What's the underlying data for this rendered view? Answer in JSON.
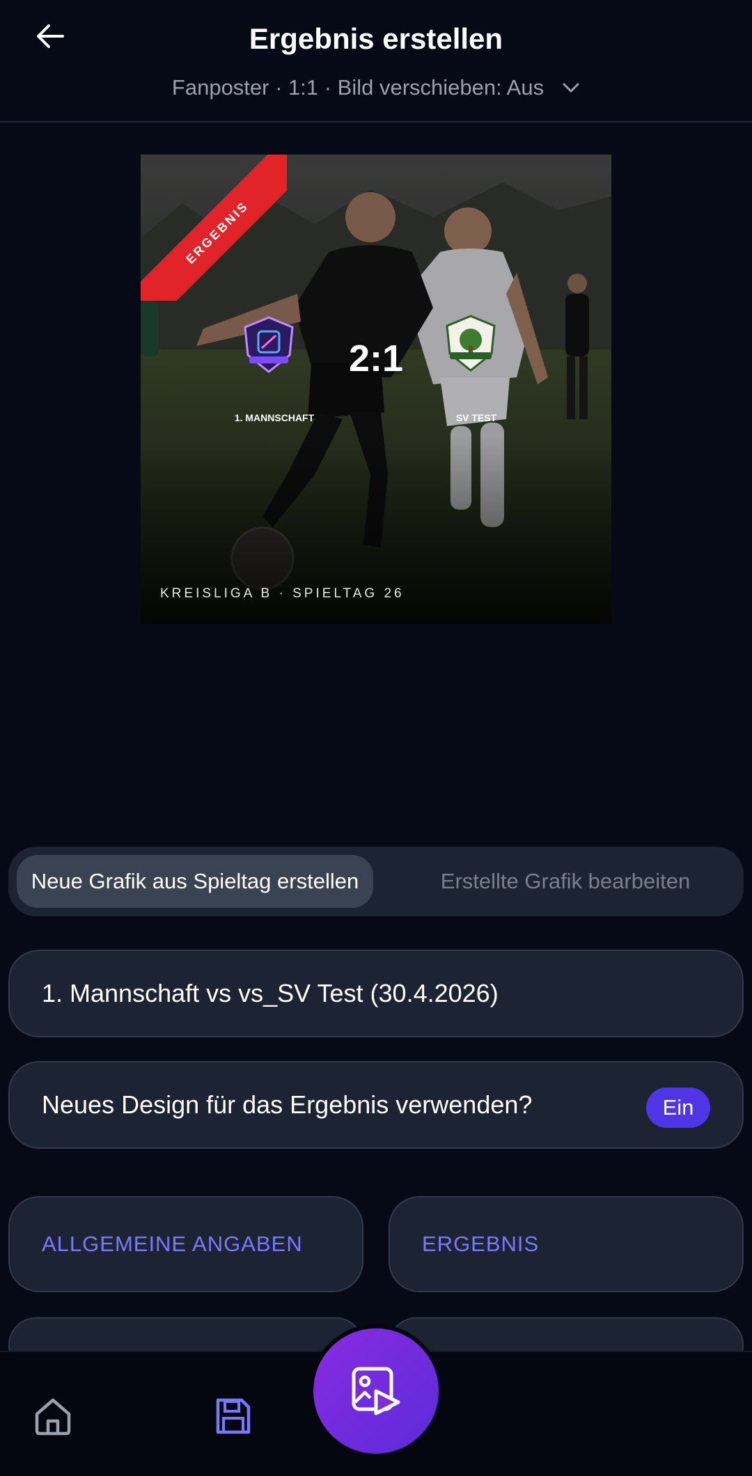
{
  "header": {
    "title": "Ergebnis erstellen",
    "subtitle": "Fanposter · 1:1 · Bild verschieben: Aus",
    "back_icon": "arrow-left-icon",
    "dropdown_icon": "chevron-down-icon"
  },
  "poster": {
    "ribbon_label": "ERGEBNIS",
    "home_team": "1. MANNSCHAFT",
    "away_team": "SV TEST",
    "score": "2:1",
    "league_line": "KREISLIGA B · SPIELTAG 26",
    "ribbon_color": "#e0242a"
  },
  "segments": {
    "active_label": "Neue Grafik aus Spieltag erstellen",
    "inactive_label": "Erstellte Grafik bearbeiten"
  },
  "match_select": {
    "label": "1. Mannschaft vs vs_SV Test (30.4.2026)"
  },
  "design_toggle": {
    "label": "Neues Design für das Ergebnis verwenden?",
    "value": "Ein"
  },
  "sections": [
    {
      "label": "ALLGEMEINE ANGABEN"
    },
    {
      "label": "ERGEBNIS"
    }
  ],
  "bottom_nav": {
    "home_icon": "home-icon",
    "save_icon": "save-icon",
    "fab_icon": "image-play-icon"
  },
  "colors": {
    "background": "#060a17",
    "accent": "#7b78ff",
    "toggle": "#4f35e6",
    "fab_start": "#8a2be2",
    "fab_end": "#5b2bd9"
  }
}
